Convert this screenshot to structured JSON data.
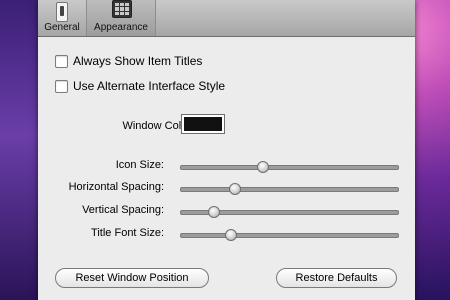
{
  "toolbar": {
    "tabs": [
      {
        "label": "General",
        "icon": "general-icon"
      },
      {
        "label": "Appearance",
        "icon": "appearance-icon",
        "selected": true
      }
    ]
  },
  "options": {
    "always_show_item_titles": {
      "label": "Always Show Item Titles",
      "checked": false
    },
    "use_alternate_interface_style": {
      "label": "Use Alternate Interface Style",
      "checked": false
    }
  },
  "window_color": {
    "label": "Window Color:",
    "value": "#111111"
  },
  "sliders": [
    {
      "label": "Icon Size:",
      "value": 0.38
    },
    {
      "label": "Horizontal Spacing:",
      "value": 0.25
    },
    {
      "label": "Vertical Spacing:",
      "value": 0.15
    },
    {
      "label": "Title Font Size:",
      "value": 0.23
    }
  ],
  "buttons": {
    "reset_window_position": "Reset Window Position",
    "restore_defaults": "Restore Defaults"
  }
}
